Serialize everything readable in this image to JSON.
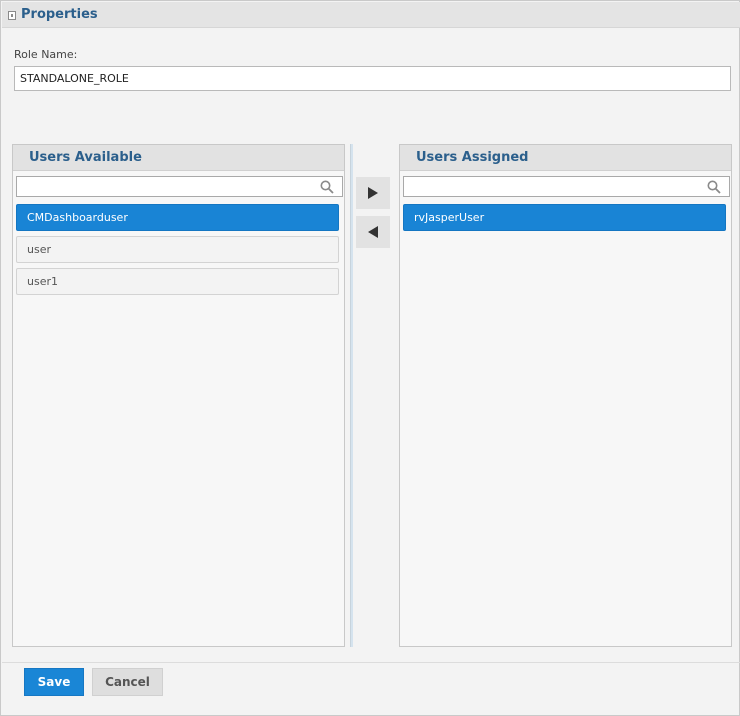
{
  "header": {
    "title": "Properties",
    "icon": "collapse-icon"
  },
  "role": {
    "label": "Role Name:",
    "value": "STANDALONE_ROLE"
  },
  "available": {
    "title": "Users Available",
    "search_placeholder": "",
    "items": [
      {
        "label": "CMDashboarduser",
        "selected": true
      },
      {
        "label": "user",
        "selected": false
      },
      {
        "label": "user1",
        "selected": false
      }
    ]
  },
  "assigned": {
    "title": "Users Assigned",
    "search_placeholder": "",
    "items": [
      {
        "label": "rvJasperUser",
        "selected": true
      }
    ]
  },
  "transfer": {
    "add_icon": "triangle-right-icon",
    "remove_icon": "triangle-left-icon"
  },
  "footer": {
    "save_label": "Save",
    "cancel_label": "Cancel"
  },
  "colors": {
    "accent": "#1984d5",
    "title_text": "#2b5f8c",
    "panel_header": "#e2e2e2"
  }
}
